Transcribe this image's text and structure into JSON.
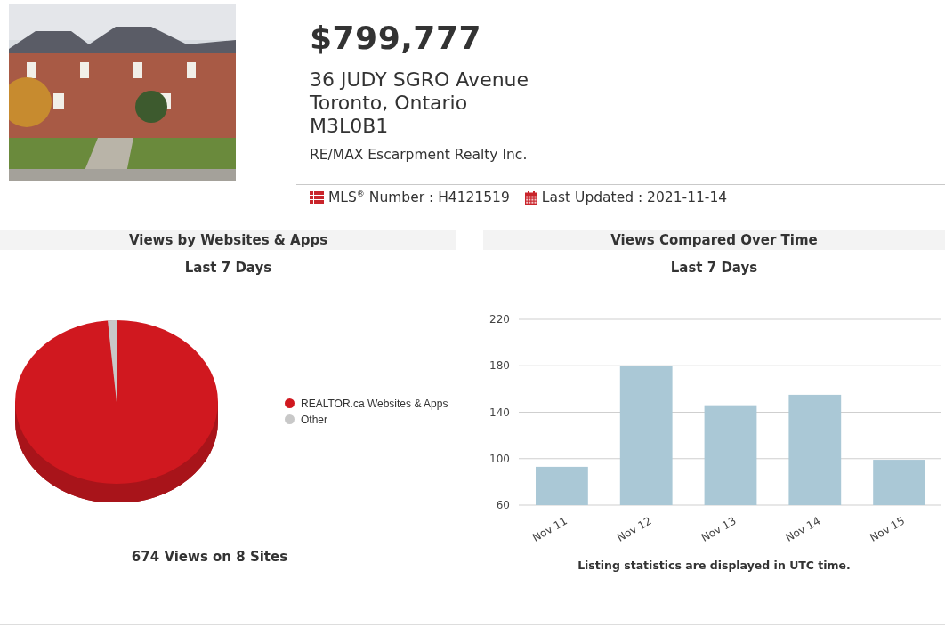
{
  "listing": {
    "price": "$799,777",
    "address_lines": [
      "36 JUDY SGRO Avenue",
      "Toronto, Ontario",
      "M3L0B1"
    ],
    "brokerage": "RE/MAX Escarpment Realty Inc."
  },
  "meta": {
    "mls_label": "MLS",
    "mls_mark": "®",
    "mls_rest": " Number : H4121519",
    "updated": "Last Updated : 2021-11-14"
  },
  "views_by_site": {
    "title": "Views by Websites & Apps",
    "subtitle": "Last 7 Days",
    "legend": [
      {
        "label": "REALTOR.ca Websites & Apps",
        "color": "#d0181f"
      },
      {
        "label": "Other",
        "color": "#c8c8c8"
      }
    ],
    "total": "674 Views on 8 Sites"
  },
  "views_over_time": {
    "title": "Views Compared Over Time",
    "subtitle": "Last 7 Days",
    "chart_data": {
      "type": "bar",
      "categories": [
        "Nov 11",
        "Nov 12",
        "Nov 13",
        "Nov 14",
        "Nov 15"
      ],
      "series": [
        {
          "color": "#aac8d6",
          "values": [
            93,
            180,
            146,
            155,
            99
          ]
        }
      ],
      "grid": true,
      "ylim": [
        60,
        220
      ],
      "yticks": [
        60,
        100,
        140,
        180,
        220
      ]
    },
    "note": "Listing statistics are displayed in UTC time."
  }
}
